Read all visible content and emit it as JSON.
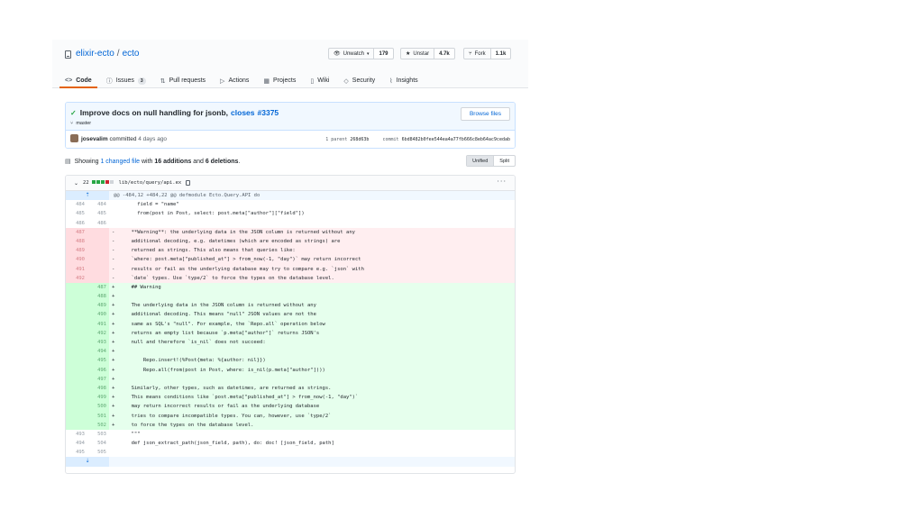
{
  "repo": {
    "owner": "elixir-ecto",
    "separator": "/",
    "name": "ecto"
  },
  "actions": {
    "watch": {
      "label": "Unwatch",
      "count": "179"
    },
    "star": {
      "label": "Unstar",
      "count": "4.7k"
    },
    "fork": {
      "label": "Fork",
      "count": "1.1k"
    }
  },
  "tabs": [
    {
      "label": "Code",
      "icon": "code-icon"
    },
    {
      "label": "Issues",
      "badge": "3",
      "icon": "issue-icon"
    },
    {
      "label": "Pull requests",
      "icon": "pull-request-icon"
    },
    {
      "label": "Actions",
      "icon": "play-icon"
    },
    {
      "label": "Projects",
      "icon": "project-icon"
    },
    {
      "label": "Wiki",
      "icon": "book-icon"
    },
    {
      "label": "Security",
      "icon": "shield-icon"
    },
    {
      "label": "Insights",
      "icon": "graph-icon"
    }
  ],
  "commit": {
    "title": "Improve docs on null handling for jsonb,",
    "title_link": "closes",
    "issue_link": "#3375",
    "branch": "master",
    "browse_label": "Browse files",
    "author": "josevalim",
    "action": "committed",
    "date": "4 days ago",
    "parent_label": "1 parent",
    "parent_sha": "268d63b",
    "commit_label": "commit",
    "commit_sha": "6bd8482b0fee544ea4a77fb666c8eb64ac9cedab"
  },
  "summary": {
    "showing": "Showing",
    "changed": "1 changed file",
    "with": "with",
    "additions": "16 additions",
    "and": "and",
    "deletions": "6 deletions",
    "end": "."
  },
  "view_toggle": {
    "unified": "Unified",
    "split": "Split"
  },
  "file": {
    "change_count": "22",
    "path": "lib/ecto/query/api.ex"
  },
  "diff": {
    "hunk_header": "@@ -484,12 +484,22 @@ defmodule Ecto.Query.API do",
    "lines": [
      {
        "t": "ctx",
        "o": "484",
        "n": "484",
        "m": "",
        "c": "    field = \"name\""
      },
      {
        "t": "ctx",
        "o": "485",
        "n": "485",
        "m": "",
        "c": "    from(post in Post, select: post.meta[\"author\"][\"field\"])"
      },
      {
        "t": "ctx",
        "o": "486",
        "n": "486",
        "m": "",
        "c": ""
      },
      {
        "t": "del",
        "o": "487",
        "n": "",
        "m": "-",
        "c": "  **Warning**: the underlying data in the JSON column is returned without any"
      },
      {
        "t": "del",
        "o": "488",
        "n": "",
        "m": "-",
        "c": "  additional decoding, e.g. datetimes (which are encoded as strings) are"
      },
      {
        "t": "del",
        "o": "489",
        "n": "",
        "m": "-",
        "c": "  returned as strings. This also means that queries like:"
      },
      {
        "t": "del",
        "o": "490",
        "n": "",
        "m": "-",
        "c": "  `where: post.meta[\"published_at\"] > from_now(-1, \"day\")` may return incorrect"
      },
      {
        "t": "del",
        "o": "491",
        "n": "",
        "m": "-",
        "c": "  results or fail as the underlying database may try to compare e.g. `json` with"
      },
      {
        "t": "del",
        "o": "492",
        "n": "",
        "m": "-",
        "c": "  `date` types. Use `type/2` to force the types on the database level."
      },
      {
        "t": "add",
        "o": "",
        "n": "487",
        "m": "+",
        "c": "  ## Warning"
      },
      {
        "t": "add",
        "o": "",
        "n": "488",
        "m": "+",
        "c": ""
      },
      {
        "t": "add",
        "o": "",
        "n": "489",
        "m": "+",
        "c": "  The underlying data in the JSON column is returned without any"
      },
      {
        "t": "add",
        "o": "",
        "n": "490",
        "m": "+",
        "c": "  additional decoding. This means \"null\" JSON values are not the"
      },
      {
        "t": "add",
        "o": "",
        "n": "491",
        "m": "+",
        "c": "  same as SQL's \"null\". For example, the `Repo.all` operation below"
      },
      {
        "t": "add",
        "o": "",
        "n": "492",
        "m": "+",
        "c": "  returns an empty list because `p.meta[\"author\"]` returns JSON's"
      },
      {
        "t": "add",
        "o": "",
        "n": "493",
        "m": "+",
        "c": "  null and therefore `is_nil` does not succeed:"
      },
      {
        "t": "add",
        "o": "",
        "n": "494",
        "m": "+",
        "c": ""
      },
      {
        "t": "add",
        "o": "",
        "n": "495",
        "m": "+",
        "c": "      Repo.insert!(%Post{meta: %{author: nil}})"
      },
      {
        "t": "add",
        "o": "",
        "n": "496",
        "m": "+",
        "c": "      Repo.all(from(post in Post, where: is_nil(p.meta[\"author\"])))"
      },
      {
        "t": "add",
        "o": "",
        "n": "497",
        "m": "+",
        "c": ""
      },
      {
        "t": "add",
        "o": "",
        "n": "498",
        "m": "+",
        "c": "  Similarly, other types, such as datetimes, are returned as strings."
      },
      {
        "t": "add",
        "o": "",
        "n": "499",
        "m": "+",
        "c": "  This means conditions like `post.meta[\"published_at\"] > from_now(-1, \"day\")`"
      },
      {
        "t": "add",
        "o": "",
        "n": "500",
        "m": "+",
        "c": "  may return incorrect results or fail as the underlying database"
      },
      {
        "t": "add",
        "o": "",
        "n": "501",
        "m": "+",
        "c": "  tries to compare incompatible types. You can, however, use `type/2`"
      },
      {
        "t": "add",
        "o": "",
        "n": "502",
        "m": "+",
        "c": "  to force the types on the database level."
      },
      {
        "t": "ctx",
        "o": "493",
        "n": "503",
        "m": "",
        "c": "  \"\"\""
      },
      {
        "t": "ctx",
        "o": "494",
        "n": "504",
        "m": "",
        "c": "  def json_extract_path(json_field, path), do: doc! [json_field, path]"
      },
      {
        "t": "ctx",
        "o": "495",
        "n": "505",
        "m": "",
        "c": ""
      }
    ]
  }
}
